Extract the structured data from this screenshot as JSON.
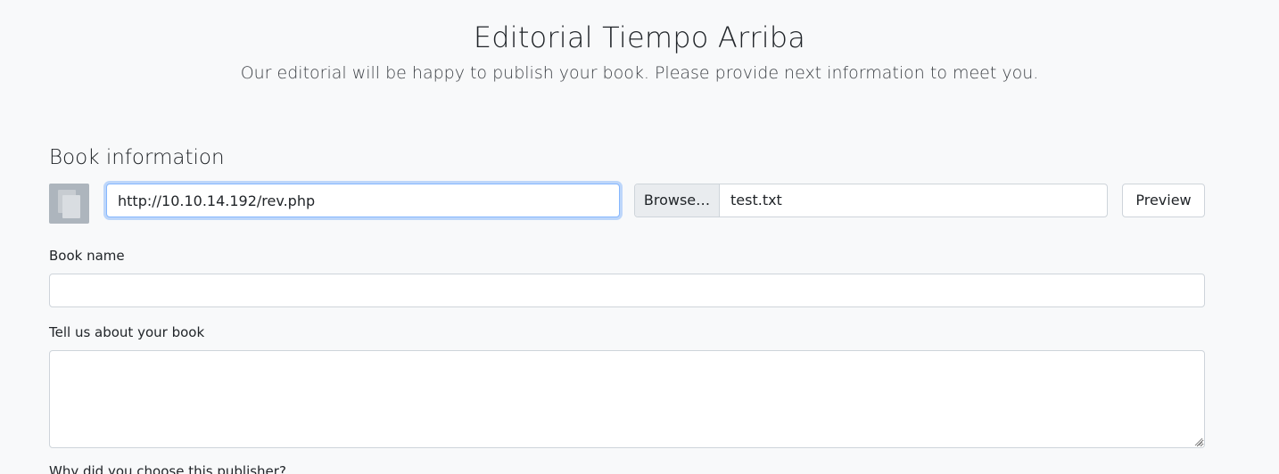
{
  "header": {
    "title": "Editorial Tiempo Arriba",
    "subtitle": "Our editorial will be happy to publish your book. Please provide next information to meet you."
  },
  "book_info": {
    "section_title": "Book information",
    "cover_url_value": "http://10.10.14.192/rev.php",
    "file_browse_label": "Browse…",
    "file_name": "test.txt",
    "preview_label": "Preview"
  },
  "book_name": {
    "label": "Book name",
    "value": ""
  },
  "about_book": {
    "label": "Tell us about your book",
    "value": ""
  },
  "why_publisher": {
    "label": "Why did you choose this publisher?"
  },
  "colors": {
    "page_background": "#f8f9fa",
    "focus_border": "#86b7fe",
    "input_border": "#ced4da",
    "icon_background": "#adb5bd"
  },
  "icons": {
    "cover": "book-cover-icon"
  }
}
